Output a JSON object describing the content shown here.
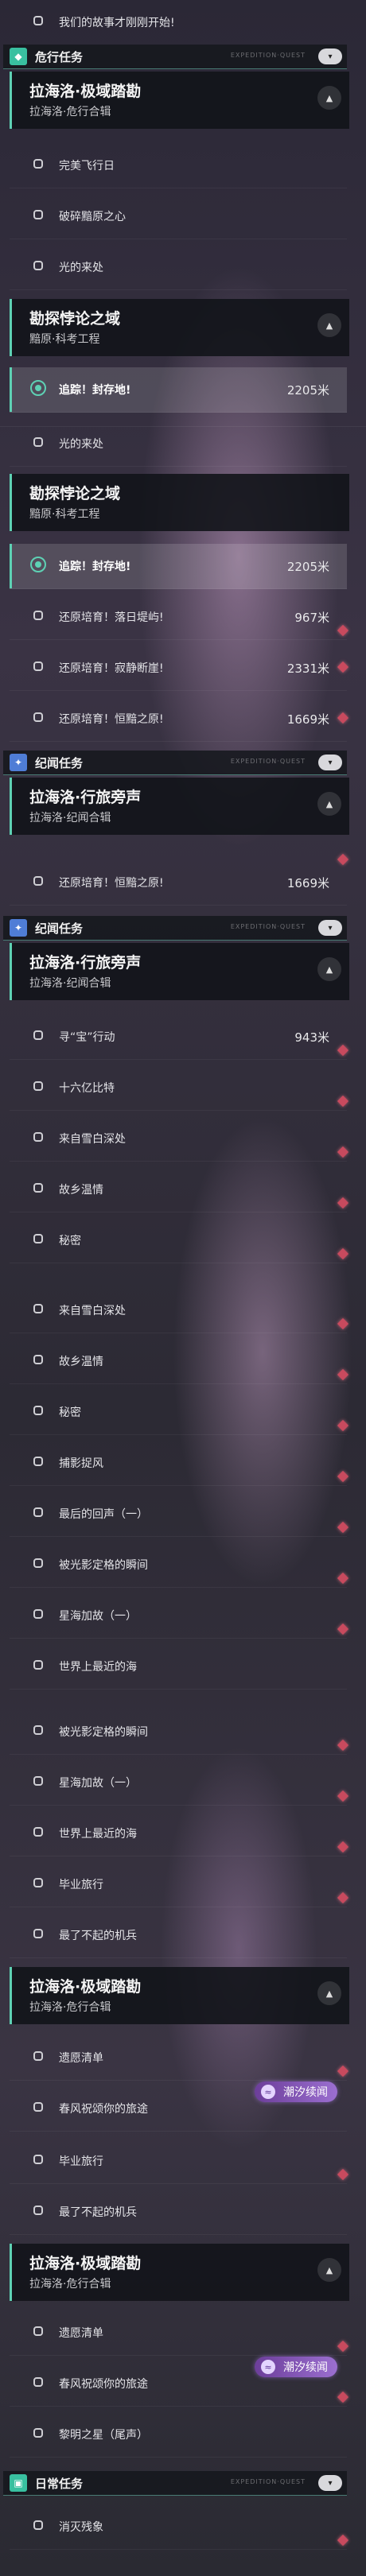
{
  "screens": [
    {
      "top_quest": {
        "title": "我们的故事才刚刚开始!"
      },
      "category": {
        "title": "危行任务",
        "icon": "diamond-icon",
        "deco": "EXPEDITION·QUEST",
        "badge": "▾"
      },
      "chain": {
        "title": "拉海洛·极域踏勘",
        "subtitle": "拉海洛·危行合辑",
        "toggle": "▲"
      },
      "quests": [
        "完美飞行日",
        "破碎黯原之心",
        "光的来处"
      ]
    }
  ],
  "blocks": {
    "b1": {
      "chain": {
        "title": "勘探悖论之域",
        "subtitle": "黯原·科考工程",
        "toggle": "▲"
      },
      "active": {
        "title": "追踪！封存地!",
        "distance": "2205米"
      }
    },
    "b2": {
      "quest": "光的来处",
      "chain": {
        "title": "勘探悖论之域",
        "subtitle": "黯原·科考工程",
        "toggle": "▲"
      },
      "active": {
        "title": "追踪！封存地!",
        "distance": "2205米"
      },
      "quests": [
        {
          "title": "还原培育！落日堤屿!",
          "distance": "967米"
        },
        {
          "title": "还原培育！寂静断崖!",
          "distance": "2331米"
        },
        {
          "title": "还原培育！恒黯之原!",
          "distance": "1669米"
        }
      ]
    },
    "b3": {
      "category": {
        "title": "纪闻任务",
        "icon": "sparkle-icon",
        "deco": "EXPEDITION·QUEST",
        "badge": "▾"
      },
      "chain": {
        "title": "拉海洛·行旅旁声",
        "subtitle": "拉海洛·纪闻合辑",
        "toggle": "▲"
      },
      "quest": {
        "title": "还原培育！恒黯之原!",
        "distance": "1669米"
      }
    },
    "b4": {
      "category": {
        "title": "纪闻任务",
        "icon": "sparkle-icon",
        "deco": "EXPEDITION·QUEST",
        "badge": "▾"
      },
      "chain": {
        "title": "拉海洛·行旅旁声",
        "subtitle": "拉海洛·纪闻合辑",
        "toggle": "▲"
      },
      "quests": [
        {
          "title": "寻“宝”行动",
          "distance": "943米"
        },
        {
          "title": "十六亿比特",
          "distance": ""
        },
        {
          "title": "来自雪白深处",
          "distance": ""
        },
        {
          "title": "故乡温情",
          "distance": ""
        },
        {
          "title": "秘密",
          "distance": ""
        }
      ]
    },
    "b5": {
      "quests": [
        "来自雪白深处",
        "故乡温情",
        "秘密",
        "捕影捉风",
        "最后的回声（一）",
        "被光影定格的瞬间",
        "星海加故（一）",
        "世界上最近的海"
      ]
    },
    "b6": {
      "quests": [
        "被光影定格的瞬间",
        "星海加故（一）",
        "世界上最近的海",
        "毕业旅行",
        "最了不起的机兵"
      ],
      "chain": {
        "title": "拉海洛·极域踏勘",
        "subtitle": "拉海洛·危行合辑",
        "toggle": "▲"
      },
      "tail_quests": [
        "遗愿清单",
        "春风祝颂你的旅途"
      ],
      "tide_label": "潮汐续闻"
    },
    "b7": {
      "quests": [
        "毕业旅行",
        "最了不起的机兵"
      ],
      "chain": {
        "title": "拉海洛·极域踏勘",
        "subtitle": "拉海洛·危行合辑",
        "toggle": "▲"
      },
      "tail_quests": [
        "遗愿清单",
        "春风祝颂你的旅途",
        "黎明之星（尾声）"
      ],
      "tide_label": "潮汐续闻"
    },
    "b8": {
      "category": {
        "title": "日常任务",
        "icon": "square-icon",
        "deco": "EXPEDITION·QUEST",
        "badge": "▾"
      },
      "quest": "消灭残象"
    }
  }
}
